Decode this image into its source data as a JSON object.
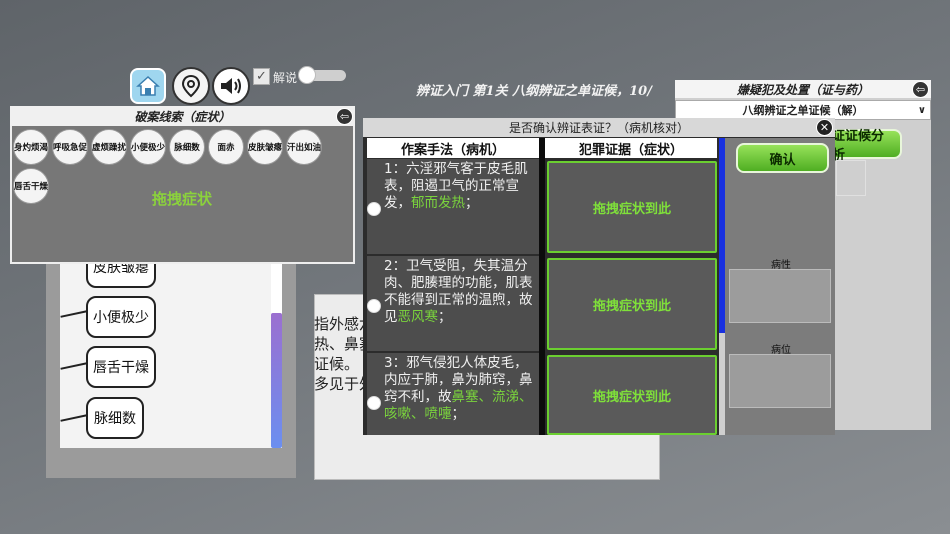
{
  "toolbar": {
    "explain_label": "解说",
    "explain_checked": true
  },
  "title": "辨证入门 第1关 八纲辨证之单证候，10/",
  "clue_panel": {
    "header": "破案线索（症状）",
    "symptoms": [
      "身灼烦渴",
      "呼吸急促",
      "虚烦躁扰",
      "小便极少",
      "脉细数",
      "面赤",
      "皮肤皱瘪",
      "汗出如油",
      "唇舌干燥"
    ],
    "drag_hint": "拖拽症状"
  },
  "bg_speech_items": [
    "皮肤皱瘪",
    "小便极少",
    "唇舌干燥",
    "脉细数"
  ],
  "bg_text": [
    "指外感六",
    "热、鼻塞",
    "证候。",
    "多见于外"
  ],
  "right_panel": {
    "header": "嫌疑犯及处置（证与药）",
    "select_value": "八纲辨证之单证候（解）",
    "analysis_button": "证证候分析",
    "confirm_button": "确认",
    "nature_label": "病性",
    "location_label": "病位"
  },
  "dialog": {
    "title": "是否确认辨证表证？（病机核对）",
    "col_method": "作案手法（病机）",
    "col_evidence": "犯罪证据（症状）",
    "drop_hint": "拖拽症状到此",
    "rows": [
      {
        "prefix": "1：六淫邪气客于皮毛肌表，阻遏卫气的正常宣发，",
        "highlight": "郁而发热",
        "suffix": "；"
      },
      {
        "prefix": "2：卫气受阻，失其温分肉、肥腠理的功能，肌表不能得到正常的温煦，故见",
        "highlight": "恶风寒",
        "suffix": "；"
      },
      {
        "prefix": "3：邪气侵犯人体皮毛，内应于肺，鼻为肺窍，鼻窍不利，故",
        "highlight": "鼻塞、流涕、咳嗽、喷嚏",
        "suffix": "；"
      }
    ]
  }
}
